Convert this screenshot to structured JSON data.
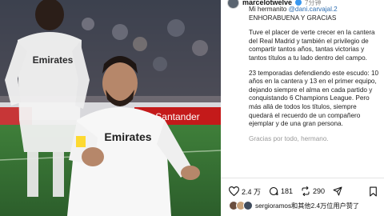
{
  "post": {
    "username": "marcelotwelve",
    "time": "7分钟",
    "paragraphs": [
      "Mi hermanito @dani.carvajal.2\nENHORABUENA Y GRACIAS",
      "Tuve el placer de verte crecer en la cantera del Real Madrid y también el privilegio de compartir tantos años, tantas victorias y tantos títulos a tu lado dentro del campo.",
      "23 temporadas defendiendo este escudo: 10 años en la cantera y 13 en el primer equipo, dejando siempre el alma en cada partido y conquistando 6 Champions League. Pero más allá de todos los títulos, siempre quedará el recuerdo de un compañero ejemplar y de una gran persona.",
      "Gracias por todo, hermano."
    ]
  },
  "photo": {
    "sponsor_left": "Emirates",
    "sponsor_main": "Emirates",
    "boards": [
      "Santander"
    ]
  },
  "actions": {
    "likes_count": "2.4 万",
    "comments_count": "181",
    "reposts_count": "290"
  },
  "likes_line": {
    "text": "sergioramos和其他2.4万位用户赞了"
  },
  "colors": {
    "accent": "#3897f0",
    "link": "#2b6cb0"
  }
}
